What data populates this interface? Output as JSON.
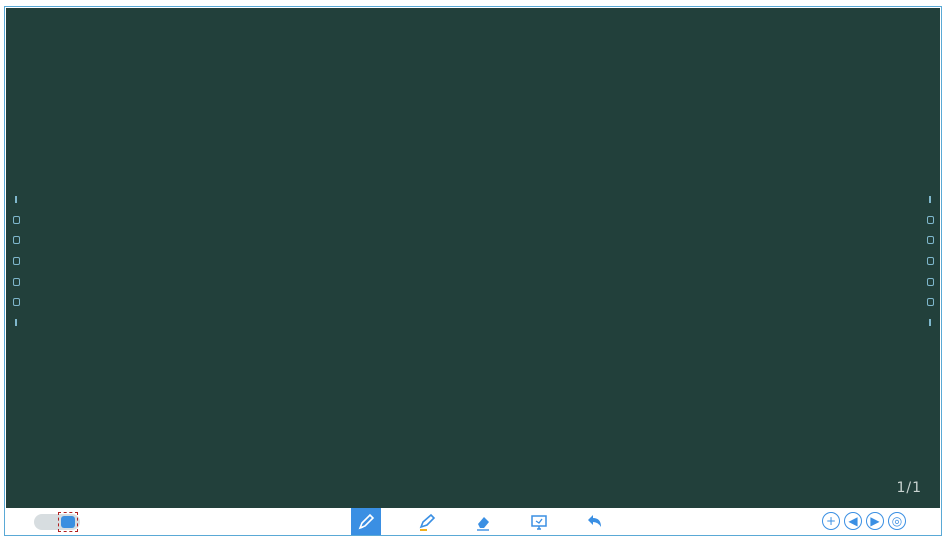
{
  "board": {
    "page_indicator": "1/1",
    "background_color": "#22403b"
  },
  "toolbar": {
    "toggle": {
      "icon": "toggle-icon",
      "state": "on"
    },
    "tools": [
      {
        "name": "pen",
        "icon": "pen-icon",
        "active": true
      },
      {
        "name": "highlighter",
        "icon": "highlighter-icon",
        "active": false
      },
      {
        "name": "eraser",
        "icon": "eraser-icon",
        "active": false
      },
      {
        "name": "screen-capture",
        "icon": "screen-icon",
        "active": false
      },
      {
        "name": "undo",
        "icon": "undo-icon",
        "active": false
      }
    ],
    "navigation": [
      {
        "name": "add-page",
        "icon": "plus-icon"
      },
      {
        "name": "previous-page",
        "icon": "arrow-left-icon"
      },
      {
        "name": "next-page",
        "icon": "arrow-right-icon"
      },
      {
        "name": "page-overview",
        "icon": "overview-icon"
      }
    ]
  },
  "colors": {
    "accent": "#3a8fe3",
    "frame_border": "#5aa9d6"
  }
}
